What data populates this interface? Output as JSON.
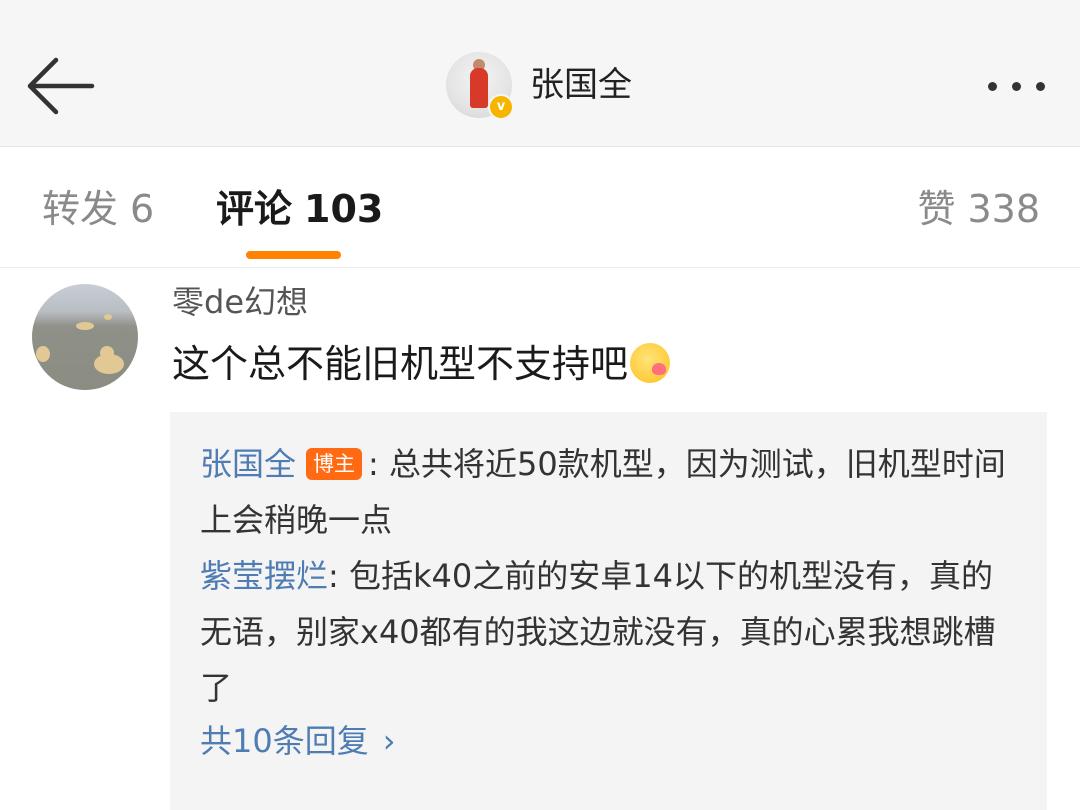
{
  "header": {
    "title": "张国全",
    "back_icon": "arrow-left-icon",
    "more_icon": "more-horizontal-icon",
    "verified_icon": "verified-badge-icon"
  },
  "tabs": [
    {
      "label": "转发",
      "count": "6",
      "active": false
    },
    {
      "label": "评论",
      "count": "103",
      "active": true
    },
    {
      "label": "赞",
      "count": "338",
      "active": false
    }
  ],
  "accent_color": "#ff8200",
  "comment": {
    "username": "零de幻想",
    "text": "这个总不能旧机型不支持吧",
    "emoji": "blushing-face-emoji"
  },
  "replies": [
    {
      "name": "张国全",
      "badge": "博主",
      "text": ": 总共将近50款机型，因为测试，旧机型时间上会稍晚一点"
    },
    {
      "name": "紫莹摆烂",
      "badge": "",
      "text": ": 包括k40之前的安卓14以下的机型没有，真的无语，别家x40都有的我这边就没有，真的心累我想跳槽了"
    }
  ],
  "more_replies": {
    "label": "共10条回复",
    "icon": "chevron-right-icon"
  }
}
